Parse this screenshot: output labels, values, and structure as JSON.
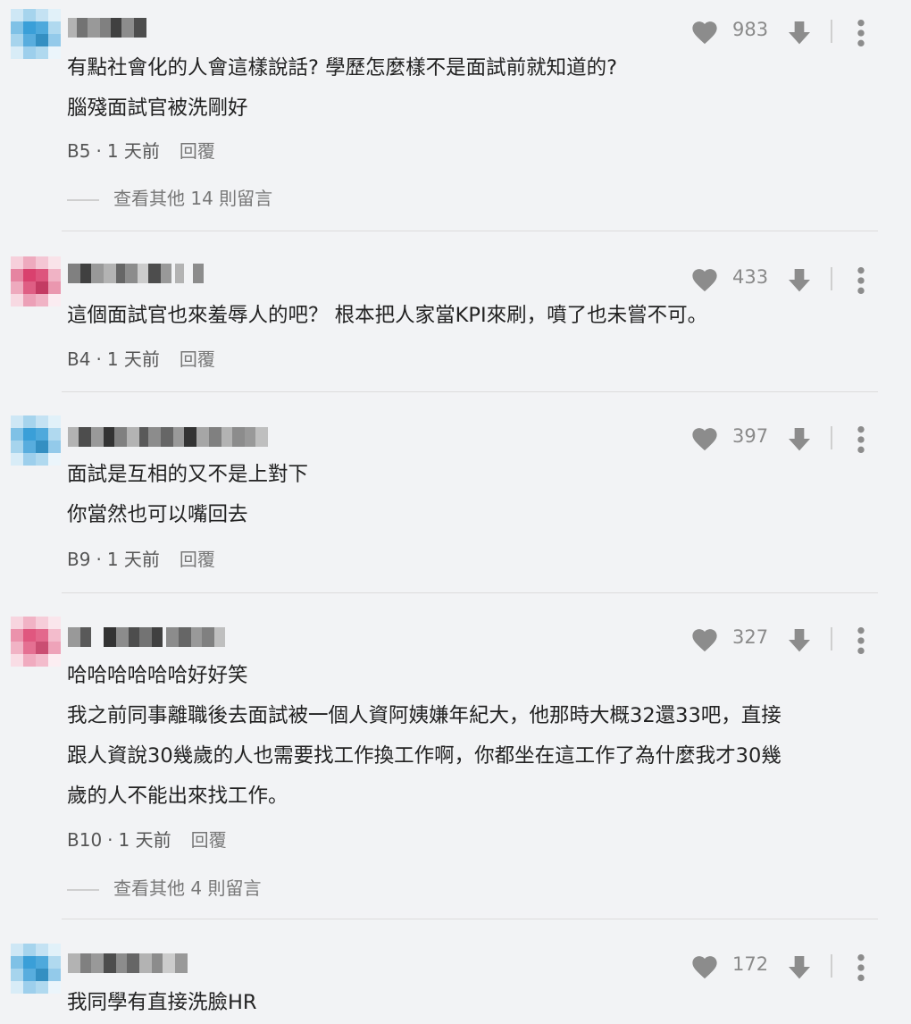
{
  "comments": [
    {
      "likes": "983",
      "lines": [
        "有點社會化的人會這樣說話? 學歷怎麼樣不是面試前就知道的?",
        "腦殘面試官被洗剛好"
      ],
      "floor": "B5",
      "time": "1 天前",
      "reply": "回覆",
      "view_more": "查看其他 14 則留言",
      "avatar_color": "#3a9fd8"
    },
    {
      "likes": "433",
      "lines": [
        "這個面試官也來羞辱人的吧？ 根本把人家當KPI來刷，噴了也未嘗不可。"
      ],
      "floor": "B4",
      "time": "1 天前",
      "reply": "回覆",
      "avatar_color": "#d9416e"
    },
    {
      "likes": "397",
      "lines": [
        "面試是互相的又不是上對下",
        "你當然也可以嘴回去"
      ],
      "floor": "B9",
      "time": "1 天前",
      "reply": "回覆",
      "avatar_color": "#3a9fd8"
    },
    {
      "likes": "327",
      "lines": [
        "哈哈哈哈哈哈好好笑",
        "我之前同事離職後去面試被一個人資阿姨嫌年紀大，他那時大概32還33吧，直接",
        "跟人資說30幾歲的人也需要找工作換工作啊，你都坐在這工作了為什麼我才30幾",
        "歲的人不能出來找工作。"
      ],
      "floor": "B10",
      "time": "1 天前",
      "reply": "回覆",
      "view_more": "查看其他 4 則留言",
      "avatar_color": "#e0577f"
    },
    {
      "likes": "172",
      "lines": [
        "我同學有直接洗臉HR"
      ],
      "avatar_color": "#3a9fd8"
    }
  ],
  "icons": {
    "like": "heart-icon",
    "dislike": "thumbs-down-icon",
    "more": "more-vertical-icon"
  },
  "colors": {
    "background": "#f2f3f5",
    "icon_gray": "#8c8c8c"
  }
}
